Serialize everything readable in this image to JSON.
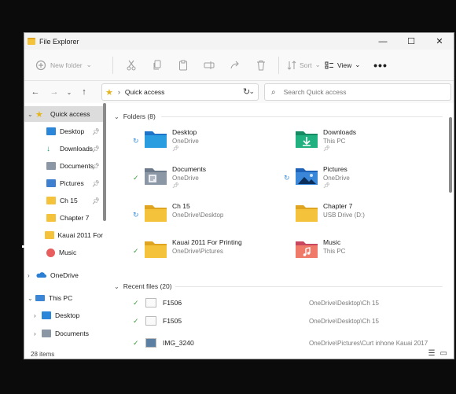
{
  "window": {
    "title": "File Explorer"
  },
  "toolbar": {
    "new_label": "New folder",
    "sort_label": "Sort",
    "view_label": "View",
    "more_label": "•••"
  },
  "address": {
    "breadcrumb": "Quick access",
    "search_placeholder": "Search Quick access"
  },
  "sidebar": {
    "items": [
      {
        "label": "Quick access",
        "chevron": "⌄",
        "icon": "star-icon"
      },
      {
        "label": "Desktop",
        "icon": "desktop-folder-icon",
        "pinned": true
      },
      {
        "label": "Downloads",
        "icon": "download-icon",
        "pinned": true
      },
      {
        "label": "Documents",
        "icon": "documents-folder-icon",
        "pinned": true
      },
      {
        "label": "Pictures",
        "icon": "pictures-folder-icon",
        "pinned": true
      },
      {
        "label": "Ch 15",
        "icon": "folder-icon",
        "pinned": true
      },
      {
        "label": "Chapter 7",
        "icon": "folder-icon"
      },
      {
        "label": "Kauai 2011 For",
        "icon": "folder-icon"
      },
      {
        "label": "Music",
        "icon": "music-icon"
      },
      {
        "label": "OneDrive",
        "chevron": "›",
        "icon": "onedrive-icon"
      },
      {
        "label": "This PC",
        "chevron": "⌄",
        "icon": "computer-icon"
      },
      {
        "label": "Desktop",
        "chevron": "›",
        "icon": "desktop-folder-icon"
      },
      {
        "label": "Documents",
        "chevron": "›",
        "icon": "documents-folder-icon"
      }
    ]
  },
  "folders": {
    "header": "Folders (8)",
    "items": [
      {
        "name": "Desktop",
        "location": "OneDrive",
        "pinned": true,
        "status": "sync"
      },
      {
        "name": "Downloads",
        "location": "This PC",
        "pinned": true,
        "status": ""
      },
      {
        "name": "Documents",
        "location": "OneDrive",
        "pinned": true,
        "status": "ok"
      },
      {
        "name": "Pictures",
        "location": "OneDrive",
        "pinned": true,
        "status": "sync"
      },
      {
        "name": "Ch 15",
        "location": "OneDrive\\Desktop",
        "pinned": false,
        "status": "sync"
      },
      {
        "name": "Chapter 7",
        "location": "USB Drive (D:)",
        "pinned": false,
        "status": ""
      },
      {
        "name": "Kauai 2011 For Printing",
        "location": "OneDrive\\Pictures",
        "pinned": false,
        "status": "ok"
      },
      {
        "name": "Music",
        "location": "This PC",
        "pinned": false,
        "status": ""
      }
    ]
  },
  "recent": {
    "header": "Recent files (20)",
    "items": [
      {
        "name": "F1506",
        "path": "OneDrive\\Desktop\\Ch 15"
      },
      {
        "name": "F1505",
        "path": "OneDrive\\Desktop\\Ch 15"
      },
      {
        "name": "IMG_3240",
        "path": "OneDrive\\Pictures\\Curt inhone Kauai 2017"
      }
    ]
  },
  "status": {
    "count": "28 items"
  },
  "colors": {
    "folder": "#f5c33b",
    "onedrive_blue": "#2a7fd4",
    "sync_ok": "#3a9a3a"
  }
}
